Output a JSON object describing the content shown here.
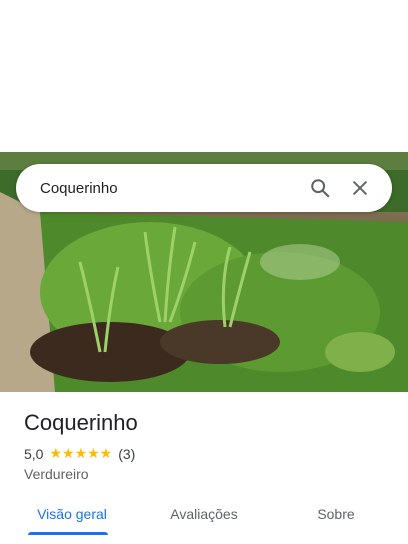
{
  "search": {
    "query": "Coquerinho",
    "search_icon": "search-icon",
    "close_icon": "close-icon"
  },
  "hero": {
    "image": "vegetable-garden-photo"
  },
  "place": {
    "title": "Coquerinho",
    "rating": "5,0",
    "stars": "★★★★★",
    "review_count": "(3)",
    "category": "Verdureiro"
  },
  "tabs": [
    {
      "label": "Visão geral",
      "active": true
    },
    {
      "label": "Avaliações",
      "active": false
    },
    {
      "label": "Sobre",
      "active": false
    }
  ],
  "colors": {
    "accent": "#1a73e8",
    "star": "#fbbc04"
  }
}
